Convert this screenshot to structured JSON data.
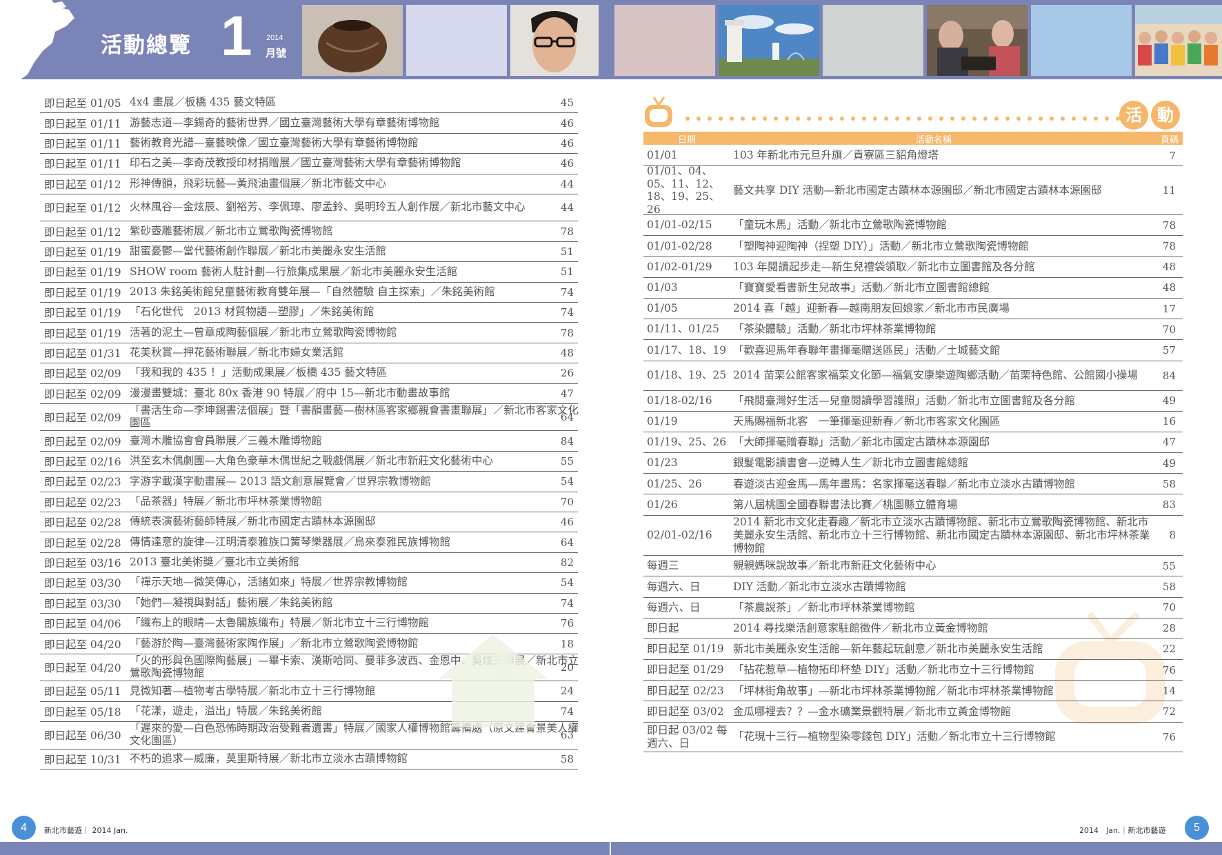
{
  "header": {
    "title": "活動總覽",
    "issue_number": "1",
    "issue_year": "2014",
    "issue_month": "月號"
  },
  "left_list": [
    {
      "date": "即日起至 01/05",
      "title": "4x4 畫展／板橋 435 藝文特區",
      "page": "45"
    },
    {
      "date": "即日起至 01/11",
      "title": "游藝志道—李錫奇的藝術世界／國立臺灣藝術大學有章藝術博物館",
      "page": "46"
    },
    {
      "date": "即日起至 01/11",
      "title": "藝術教育光譜—臺藝映像／國立臺灣藝術大學有章藝術博物館",
      "page": "46"
    },
    {
      "date": "即日起至 01/11",
      "title": "印石之美—李奇茂教授印材捐贈展／國立臺灣藝術大學有章藝術博物館",
      "page": "46"
    },
    {
      "date": "即日起至 01/12",
      "title": "形神傳韻，飛彩玩藝—黃飛油畫個展／新北市藝文中心",
      "page": "44"
    },
    {
      "date": "即日起至 01/12",
      "title": "火林風谷—金炫辰、劉裕芳、李佩璋、廖孟鈴、吳明玲五人創作展／新北市藝文中心",
      "page": "44",
      "tall": true
    },
    {
      "date": "即日起至 01/12",
      "title": "紫砂壺雕藝術展／新北市立鶯歌陶瓷博物館",
      "page": "78"
    },
    {
      "date": "即日起至 01/19",
      "title": "甜蜜憂鬱—當代藝術創作聯展／新北市美麗永安生活館",
      "page": "51"
    },
    {
      "date": "即日起至 01/19",
      "title": "SHOW room 藝術人駐計劃—行旅集成果展／新北市美麗永安生活館",
      "page": "51"
    },
    {
      "date": "即日起至 01/19",
      "title": "2013 朱銘美術館兒童藝術教育雙年展—「自然體驗 自主探索」／朱銘美術館",
      "page": "74"
    },
    {
      "date": "即日起至 01/19",
      "title": "「石化世代　2013 材質物語—塑膠」／朱銘美術館",
      "page": "74"
    },
    {
      "date": "即日起至 01/19",
      "title": "活著的泥土—曾章成陶藝個展／新北市立鶯歌陶瓷博物館",
      "page": "78"
    },
    {
      "date": "即日起至 01/31",
      "title": "花美秋賞—押花藝術聯展／新北市婦女業活館",
      "page": "48"
    },
    {
      "date": "即日起至 02/09",
      "title": "「我和我的 435 ！」活動成果展／板橋 435 藝文特區",
      "page": "26"
    },
    {
      "date": "即日起至 02/09",
      "title": "漫漫畫雙城：臺北 80x 香港 90 特展／府中 15—新北市動畫故事館",
      "page": "47"
    },
    {
      "date": "即日起至 02/09",
      "title": "「書活生命—李坤錫書法個展」暨「書韻畫藝—樹林區客家鄉親會書畫聯展」／新北市客家文化園區",
      "page": "64",
      "tall": true
    },
    {
      "date": "即日起至 02/09",
      "title": "臺灣木雕協會會員聯展／三義木雕博物館",
      "page": "84"
    },
    {
      "date": "即日起至 02/16",
      "title": "洪至玄木偶劇團—大角色豪華木偶世紀之戰戲偶展／新北市新莊文化藝術中心",
      "page": "55"
    },
    {
      "date": "即日起至 02/23",
      "title": "字游字載漢字動畫展— 2013 語文創意展覽會／世界宗教博物館",
      "page": "54"
    },
    {
      "date": "即日起至 02/23",
      "title": "「品茶器」特展／新北市坪林茶業博物館",
      "page": "70"
    },
    {
      "date": "即日起至 02/28",
      "title": "傳統表演藝術藝師特展／新北市國定古蹟林本源園邸",
      "page": "46"
    },
    {
      "date": "即日起至 02/28",
      "title": "傳情達意的旋律—江明清泰雅族口簧琴樂器展／烏來泰雅民族博物館",
      "page": "64"
    },
    {
      "date": "即日起至 03/16",
      "title": "2013 臺北美術獎／臺北市立美術館",
      "page": "82"
    },
    {
      "date": "即日起至 03/30",
      "title": "「禪示天地—微笑傳心，活諸如來」特展／世界宗教博物館",
      "page": "54"
    },
    {
      "date": "即日起至 03/30",
      "title": "「她們—凝視與對話」藝術展／朱銘美術館",
      "page": "74"
    },
    {
      "date": "即日起至 04/06",
      "title": "「織布上的眼睛—太魯閣族織布」特展／新北市立十三行博物館",
      "page": "76"
    },
    {
      "date": "即日起至 04/20",
      "title": "「藝游於陶—臺灣藝術家陶作展」／新北市立鶯歌陶瓷博物館",
      "page": "18"
    },
    {
      "date": "即日起至 04/20",
      "title": "「火的形與色國際陶藝展」—畢卡索、漢斯哈同、曼菲多波西、金恩中、吳炫三聯展／新北市立鶯歌陶瓷博物館",
      "page": "20",
      "tall": true
    },
    {
      "date": "即日起至 05/11",
      "title": "見微知著—植物考古學特展／新北市立十三行博物館",
      "page": "24"
    },
    {
      "date": "即日起至 05/18",
      "title": "「花漾，遊走，溢出」特展／朱銘美術館",
      "page": "74"
    },
    {
      "date": "即日起至 06/30",
      "title": "「遲來的愛—白色恐怖時期政治受難者遺書」特展／國家人權博物館籌備處（原文建會景美人權文化園區）",
      "page": "63",
      "tall": true
    },
    {
      "date": "即日起至 10/31",
      "title": "不朽的追求—威廉，莫里斯特展／新北市立淡水古蹟博物館",
      "page": "58"
    }
  ],
  "right_header": {
    "badge_1": "活",
    "badge_2": "動",
    "col_date": "日期",
    "col_name": "活動名稱",
    "col_page": "頁碼"
  },
  "right_list": [
    {
      "date": "01/01",
      "title": "103 年新北市元旦升旗／貢寮區三貂角燈塔",
      "page": "7"
    },
    {
      "date": "01/01、04、05、11、12、18、19、25、26",
      "title": "藝文共享 DIY 活動—新北市國定古蹟林本源園邸／新北市國定古蹟林本源園邸",
      "page": "11",
      "size": "t4"
    },
    {
      "date": "01/01-02/15",
      "title": "「童玩木馬」活動／新北市立鶯歌陶瓷博物館",
      "page": "78"
    },
    {
      "date": "01/01-02/28",
      "title": "「塑陶神迎陶神（捏塑 DIY）」活動／新北市立鶯歌陶瓷博物館",
      "page": "78"
    },
    {
      "date": "01/02-01/29",
      "title": "103 年閱讀起步走—新生兒禮袋領取／新北市立圖書館及各分館",
      "page": "48"
    },
    {
      "date": "01/03",
      "title": "「寶寶愛看書新生兒故事」活動／新北市立圖書館總館",
      "page": "48"
    },
    {
      "date": "01/05",
      "title": "2014 喜「越」迎新春—越南朋友回娘家／新北市市民廣場",
      "page": "17"
    },
    {
      "date": "01/11、01/25",
      "title": "「茶染體驗」活動／新北市坪林茶業博物館",
      "page": "70"
    },
    {
      "date": "01/17、18、19",
      "title": "「歡喜迎馬年春聯年畫揮毫贈送區民」活動／土城藝文館",
      "page": "57"
    },
    {
      "date": "01/18、19、25",
      "title": "2014 苗栗公館客家福菜文化節—福氣安康樂遊陶鄉活動／苗栗特色館、公館國小操場",
      "page": "84",
      "size": "t2"
    },
    {
      "date": "01/18-02/16",
      "title": "「飛閱臺灣好生活—兒童閱讀學習護照」活動／新北市立圖書館及各分館",
      "page": "49"
    },
    {
      "date": "01/19",
      "title": "天馬賜福新北客　一筆揮毫迎新春／新北市客家文化園區",
      "page": "16"
    },
    {
      "date": "01/19、25、26",
      "title": "「大師揮毫贈春聯」活動／新北市國定古蹟林本源園邸",
      "page": "47"
    },
    {
      "date": "01/23",
      "title": "銀髮電影讀書會—逆轉人生／新北市立圖書館總館",
      "page": "49"
    },
    {
      "date": "01/25、26",
      "title": "春遊淡古迎金馬—馬年畫馬：名家揮毫送春聯／新北市立淡水古蹟博物館",
      "page": "58"
    },
    {
      "date": "01/26",
      "title": "第八屆桃園全國春聯書法比賽／桃園縣立體育場",
      "page": "83"
    },
    {
      "date": "02/01-02/16",
      "title": "2014 新北市文化走春趣／新北市立淡水古蹟博物館、新北市立鶯歌陶瓷博物館、新北市美麗永安生活館、新北市立十三行博物館、新北市國定古蹟林本源園邸、新北市坪林茶業博物館",
      "page": "8",
      "size": "t3"
    },
    {
      "date": "每週三",
      "title": "親親媽咪說故事／新北市新莊文化藝術中心",
      "page": "55"
    },
    {
      "date": "每週六、日",
      "title": "DIY 活動／新北市立淡水古蹟博物館",
      "page": "58"
    },
    {
      "date": "每週六、日",
      "title": "「茶農說茶」／新北市坪林茶業博物館",
      "page": "70"
    },
    {
      "date": "即日起",
      "title": "2014 尋找樂活創意家駐館徵件／新北市立黃金博物館",
      "page": "28"
    },
    {
      "date": "即日起至 01/19",
      "title": "新北市美麗永安生活館—新年藝起玩創意／新北市美麗永安生活館",
      "page": "22"
    },
    {
      "date": "即日起至 01/29",
      "title": "「拈花惹草—植物拓印杯墊 DIY」活動／新北市立十三行博物館",
      "page": "76"
    },
    {
      "date": "即日起至 02/23",
      "title": "「坪林街角故事」—新北市坪林茶業博物館／新北市坪林茶業博物館",
      "page": "14"
    },
    {
      "date": "即日起至 03/02",
      "title": "金瓜哪裡去？？—金水礦業景觀特展／新北市立黃金博物館",
      "page": "72"
    },
    {
      "date": "即日起 03/02 每週六、日",
      "title": "「花現十三行—植物型染零錢包 DIY」活動／新北市立十三行博物館",
      "page": "76",
      "size": "t2"
    }
  ],
  "footer": {
    "left_page": "4",
    "left_text": "新北市藝遊｜ 2014 Jan.",
    "right_page": "5",
    "right_text": "2014　Jan.｜新北市藝遊"
  },
  "colors": {
    "header": "#7b84b6",
    "accent_orange": "#f6b76b",
    "page_circle": "#4a90d9"
  }
}
